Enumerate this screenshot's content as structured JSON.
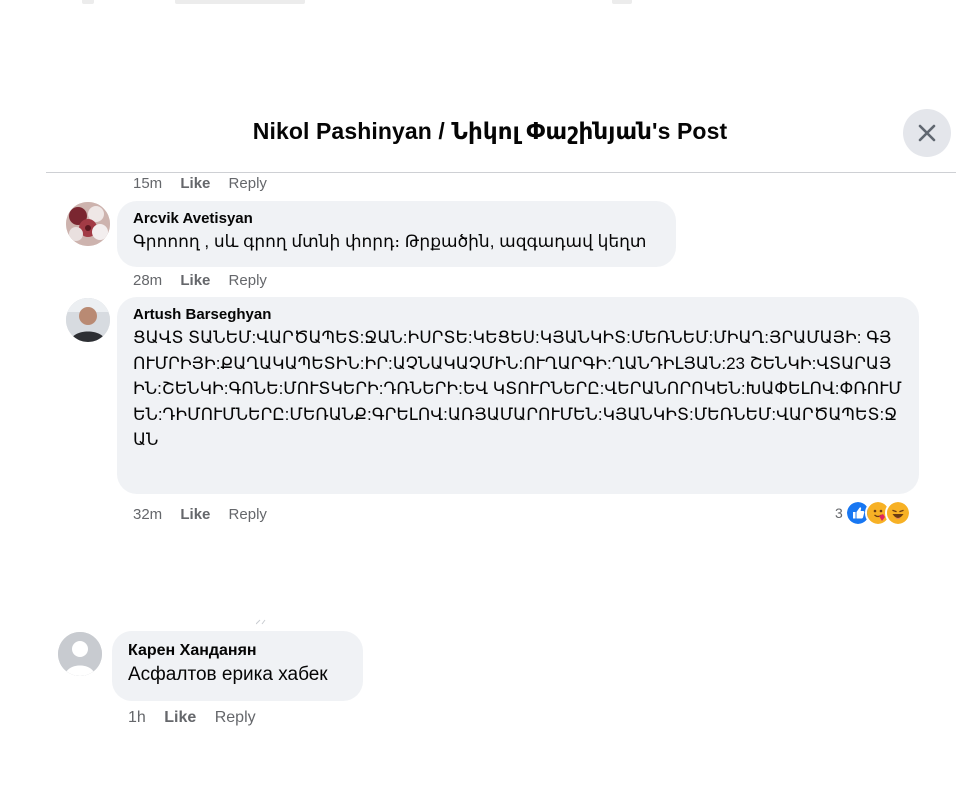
{
  "dialog": {
    "title": "Nikol Pashinyan / Նիկոլ Փաշինյան's Post",
    "close_icon": "close-icon"
  },
  "comments": [
    {
      "time": "15m",
      "like": "Like",
      "reply": "Reply"
    },
    {
      "author": "Arcvik Avetisyan",
      "text": "Գրոոող , սև գրող մտնի փորդ։ Թրքածին, ազգադավ կեղտ",
      "time": "28m",
      "like": "Like",
      "reply": "Reply"
    },
    {
      "author": "Artush Barseghyan",
      "text": "ՑԱՎՏ ՏԱՆԵՄ:ՎԱՐԾԱՊԵՏ:ՋԱՆ:ԻՍՐՏԵ:ԿԵՑԵՍ:ԿՅԱՆԿԻՏ:ՄԵՌՆԵՄ:ՄԻԱՂ:ՅՐԱՄԱՅԻ: ԳՅՈՒՄՐԻՅԻ:ՔԱՂԱԿԱՊԵՏԻՆ:ԻՐ:ԱՉՆԱԿԱՉՄԻՆ:ՈՒՂԱՐԳԻ:ՂԱՆԴԻԼՅԱՆ:23 ՇԵՆԿԻ:ՎՏԱՐԱՅԻՆ:ՇԵՆԿԻ:ԳՈՆԵ:ՄՈՒՏԿԵՐԻ:ԴՌՆԵՐԻ:ԵՎ ԿՏՈՒՐՆԵՐԸ:ՎԵՐԱՆՈՐՈԿԵՆ:ԽԱՓԵԼՈՎ:ՓՌՈՒՄԵՆ:ԴԻՄՈՒՄՆԵՐԸ:ՄԵՌԱՆՔ:ԳՐԵԼՈՎ:ԱՌՅԱՄԱՐՈՒՄԵՆ:ԿՅԱՆԿԻՏ:ՄԵՌՆԵՄ:ՎԱՐԾԱՊԵՏ:ՋԱՆ",
      "time": "32m",
      "like": "Like",
      "reply": "Reply",
      "reactions": {
        "count": "3",
        "types": [
          "like",
          "hug",
          "laugh"
        ]
      }
    },
    {
      "author": "Карен Ханданян",
      "text": "Асфалтов ерика хабек",
      "time": "1h",
      "like": "Like",
      "reply": "Reply"
    }
  ],
  "colors": {
    "bubble": "#f0f2f5",
    "secondary_text": "#65676b",
    "like_blue": "#1877f2",
    "emoji_yellow": "#f7b125"
  }
}
